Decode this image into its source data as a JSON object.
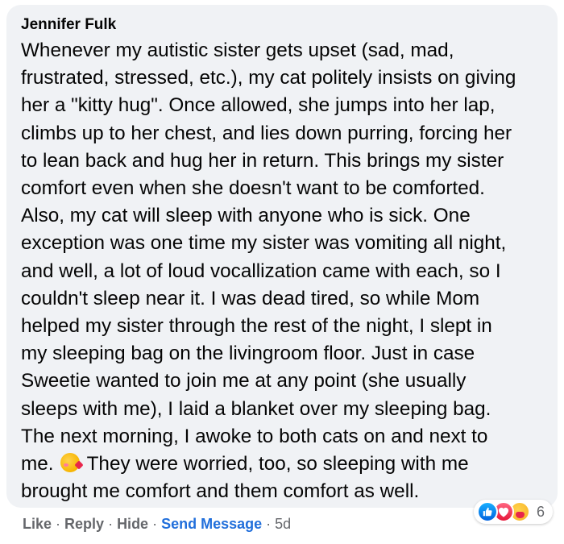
{
  "comment": {
    "author": "Jennifer Fulk",
    "lines": [
      "Whenever my autistic sister gets upset (sad, mad,",
      "frustrated, stressed, etc.), my cat politely insists on giving",
      "her a \"kitty hug\". Once allowed, she jumps into her lap,",
      "climbs up to her chest, and lies down purring, forcing her",
      "to lean back and hug her in return. This brings my sister",
      "comfort even when she doesn't want to be comforted.",
      "Also, my cat will sleep with anyone who is sick. One",
      "exception was one time my sister was vomiting all night,",
      "and well, a lot of loud vocallization came with each, so I",
      "couldn't sleep near it. I was dead tired, so while Mom",
      "helped my sister through the rest of the night, I slept in",
      "my sleeping bag on the livingroom floor. Just in case",
      "Sweetie wanted to join me at any point (she usually",
      "sleeps with me), I laid a blanket over my sleeping bag.",
      "The next morning, I awoke to both cats on and next to"
    ],
    "line16_before_emoji": "me.",
    "line16_emoji": "smiling-face-with-hearts-icon",
    "line16_after_emoji": "They were worried, too, so sleeping with me",
    "line17": "brought me comfort and them comfort as well."
  },
  "reactions": {
    "icons": [
      "like-icon",
      "love-icon",
      "care-icon"
    ],
    "count": "6"
  },
  "actions": {
    "like": "Like",
    "reply": "Reply",
    "hide": "Hide",
    "send_message": "Send Message",
    "separator": "·",
    "timestamp": "5d"
  },
  "colors": {
    "bubble_bg": "#f0f2f5",
    "text": "#050505",
    "meta": "#65676b",
    "link_blue": "#216fdb"
  }
}
